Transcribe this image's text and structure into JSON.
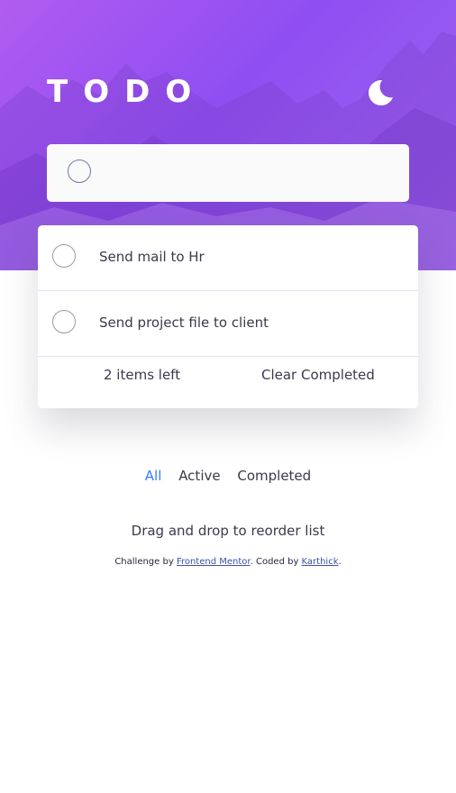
{
  "header": {
    "title": "TODO",
    "theme_toggle_icon": "moon-icon"
  },
  "new_todo": {
    "value": "",
    "placeholder": ""
  },
  "todos": [
    {
      "text": "Send mail to Hr",
      "completed": false
    },
    {
      "text": "Send project file to client",
      "completed": false
    }
  ],
  "list_footer": {
    "items_left": "2 items left",
    "clear_label": "Clear Completed"
  },
  "filters": {
    "all": "All",
    "active": "Active",
    "completed": "Completed",
    "selected": "All"
  },
  "hint": "Drag and drop to reorder list",
  "attribution": {
    "prefix": "Challenge by ",
    "link1": "Frontend Mentor",
    "middle": ". Coded by ",
    "link2": "Karthick",
    "suffix": "."
  },
  "colors": {
    "accent": "#3a7bfd",
    "hero_start": "#b15cf0",
    "hero_end": "#8f4ef2"
  }
}
